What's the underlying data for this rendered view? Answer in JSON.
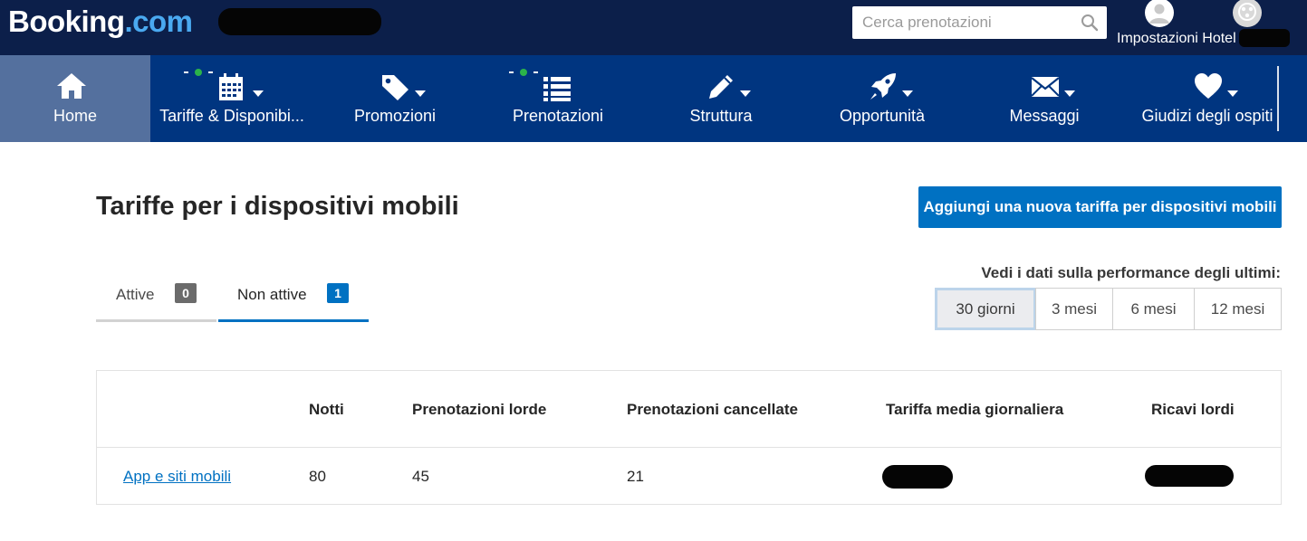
{
  "brand": {
    "name_main": "Booking",
    "name_suffix": ".com"
  },
  "header": {
    "search": {
      "placeholder": "Cerca prenotazioni",
      "value": ""
    },
    "settings_label": "Impostazioni Hotel"
  },
  "nav": {
    "items": [
      {
        "label": "Home",
        "icon": "home-icon",
        "active": true
      },
      {
        "label": "Tariffe & Disponibi...",
        "icon": "calendar-icon",
        "active": false
      },
      {
        "label": "Promozioni",
        "icon": "tag-icon",
        "active": false
      },
      {
        "label": "Prenotazioni",
        "icon": "list-icon",
        "active": false
      },
      {
        "label": "Struttura",
        "icon": "pencil-icon",
        "active": false
      },
      {
        "label": "Opportunità",
        "icon": "rocket-icon",
        "active": false
      },
      {
        "label": "Messaggi",
        "icon": "envelope-icon",
        "active": false
      },
      {
        "label": "Giudizi degli ospiti",
        "icon": "heart-icon",
        "active": false
      }
    ]
  },
  "page": {
    "title": "Tariffe per i dispositivi mobili",
    "add_button": "Aggiungi una nuova tariffa per dispositivi mobili"
  },
  "tabs": [
    {
      "label": "Attive",
      "count": "0",
      "active": false
    },
    {
      "label": "Non attive",
      "count": "1",
      "active": true
    }
  ],
  "performance": {
    "label": "Vedi i dati sulla performance degli ultimi:",
    "periods": [
      "30 giorni",
      "3 mesi",
      "6 mesi",
      "12 mesi"
    ],
    "selected": "30 giorni"
  },
  "table": {
    "columns": [
      "",
      "Notti",
      "Prenotazioni lorde",
      "Prenotazioni cancellate",
      "Tariffa media giornaliera",
      "Ricavi lordi"
    ],
    "rows": [
      {
        "name": "App e siti mobili",
        "notti": "80",
        "lorde": "45",
        "cancellate": "21",
        "tariffa": "",
        "ricavi": ""
      }
    ]
  },
  "colors": {
    "topbar": "#0c1f4a",
    "navbar": "#003580",
    "nav_active": "#54709e",
    "primary": "#0071c2",
    "badge_inactive": "#6b6b6b",
    "badge_active": "#0071c2",
    "indicator_dot": "#2bb34a"
  }
}
